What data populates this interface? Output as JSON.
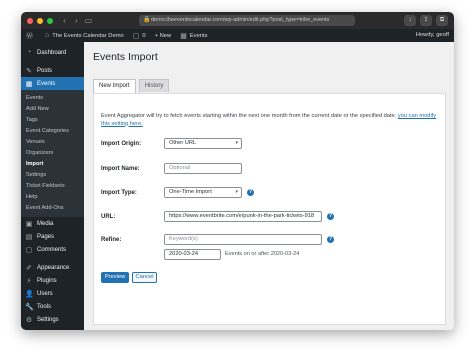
{
  "browser": {
    "url": "demo.theeventscalendar.com/wp-admin/edit.php?post_type=tribe_events"
  },
  "adminbar": {
    "site_name": "The Events Calendar Demo",
    "comments_count": "0",
    "new_label": "+ New",
    "events_label": "Events",
    "howdy": "Howdy, geoff"
  },
  "sidebar": {
    "items_top": [
      {
        "label": "Dashboard",
        "icon": "dashboard-icon"
      },
      {
        "label": "Posts",
        "icon": "pin-icon"
      },
      {
        "label": "Events",
        "icon": "calendar-icon"
      }
    ],
    "submenu": [
      "Events",
      "Add New",
      "Tags",
      "Event Categories",
      "Venues",
      "Organizers",
      "Import",
      "Settings",
      "Ticket Fieldsets",
      "Help",
      "Event Add-Ons"
    ],
    "items_bottom": [
      {
        "label": "Media",
        "icon": "media-icon"
      },
      {
        "label": "Pages",
        "icon": "page-icon"
      },
      {
        "label": "Comments",
        "icon": "comment-icon"
      },
      {
        "label": "Appearance",
        "icon": "brush-icon"
      },
      {
        "label": "Plugins",
        "icon": "plugin-icon"
      },
      {
        "label": "Users",
        "icon": "user-icon"
      },
      {
        "label": "Tools",
        "icon": "wrench-icon"
      },
      {
        "label": "Settings",
        "icon": "settings-icon"
      }
    ]
  },
  "main": {
    "title": "Events Import",
    "tabs": [
      "New Import",
      "History"
    ],
    "description": "Event Aggregator will try to fetch events starting within the next one month from the current date or the specified date;",
    "description_link": "you can modify this setting here.",
    "form": {
      "origin_label": "Import Origin:",
      "origin_value": "Other URL",
      "name_label": "Import Name:",
      "name_placeholder": "Optional",
      "type_label": "Import Type:",
      "type_value": "One-Time Import",
      "url_label": "URL:",
      "url_value": "https://www.eventbrite.com/e/punk-in-the-park-tickets-918",
      "refine_label": "Refine:",
      "keyword_placeholder": "Keyword(s)",
      "date_value": "2020-03-24",
      "date_note": "Events on or after 2020-03-24"
    },
    "buttons": {
      "preview": "Preview",
      "cancel": "Cancel"
    }
  },
  "colors": {
    "accent": "#2271b1",
    "sidebar_bg": "#1d2327",
    "chrome_bg": "#2b2b2d"
  }
}
